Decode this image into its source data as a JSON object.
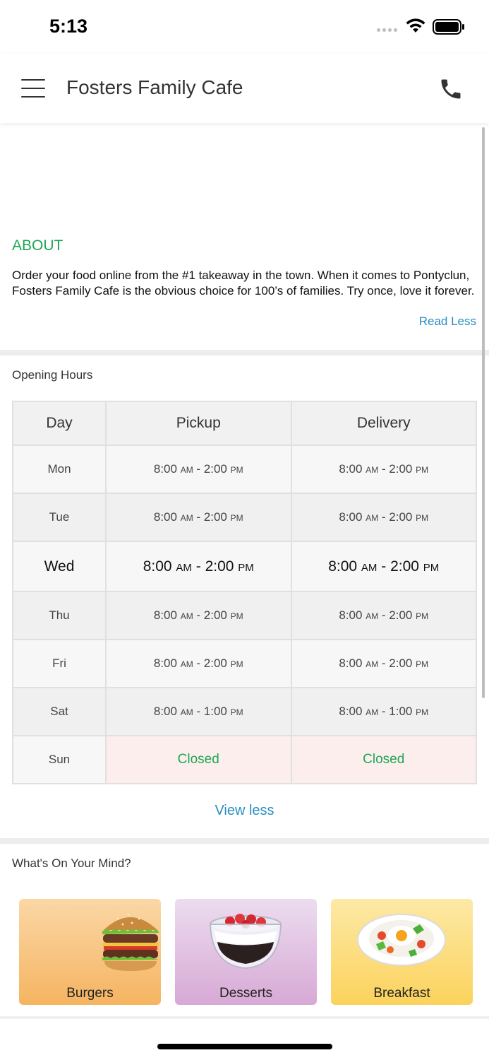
{
  "status": {
    "time": "5:13"
  },
  "header": {
    "title": "Fosters Family Cafe"
  },
  "about": {
    "title": "ABOUT",
    "text": "Order your food online from the #1 takeaway in the town. When it comes to Pontyclun, Fosters Family Cafe is the obvious choice for 100’s of families. Try once, love it forever.",
    "toggle": "Read Less"
  },
  "hours": {
    "title": "Opening Hours",
    "columns": [
      "Day",
      "Pickup",
      "Delivery"
    ],
    "rows": [
      {
        "day": "Mon",
        "pickup_open": "8:00",
        "pickup_open_ampm": "AM",
        "pickup_close": "2:00",
        "pickup_close_ampm": "PM",
        "delivery_open": "8:00",
        "delivery_open_ampm": "AM",
        "delivery_close": "2:00",
        "delivery_close_ampm": "PM"
      },
      {
        "day": "Tue",
        "pickup_open": "8:00",
        "pickup_open_ampm": "AM",
        "pickup_close": "2:00",
        "pickup_close_ampm": "PM",
        "delivery_open": "8:00",
        "delivery_open_ampm": "AM",
        "delivery_close": "2:00",
        "delivery_close_ampm": "PM"
      },
      {
        "day": "Wed",
        "pickup_open": "8:00",
        "pickup_open_ampm": "AM",
        "pickup_close": "2:00",
        "pickup_close_ampm": "PM",
        "delivery_open": "8:00",
        "delivery_open_ampm": "AM",
        "delivery_close": "2:00",
        "delivery_close_ampm": "PM"
      },
      {
        "day": "Thu",
        "pickup_open": "8:00",
        "pickup_open_ampm": "AM",
        "pickup_close": "2:00",
        "pickup_close_ampm": "PM",
        "delivery_open": "8:00",
        "delivery_open_ampm": "AM",
        "delivery_close": "2:00",
        "delivery_close_ampm": "PM"
      },
      {
        "day": "Fri",
        "pickup_open": "8:00",
        "pickup_open_ampm": "AM",
        "pickup_close": "2:00",
        "pickup_close_ampm": "PM",
        "delivery_open": "8:00",
        "delivery_open_ampm": "AM",
        "delivery_close": "2:00",
        "delivery_close_ampm": "PM"
      },
      {
        "day": "Sat",
        "pickup_open": "8:00",
        "pickup_open_ampm": "AM",
        "pickup_close": "1:00",
        "pickup_close_ampm": "PM",
        "delivery_open": "8:00",
        "delivery_open_ampm": "AM",
        "delivery_close": "1:00",
        "delivery_close_ampm": "PM"
      },
      {
        "day": "Sun",
        "pickup": "Closed",
        "delivery": "Closed"
      }
    ],
    "toggle": "View less"
  },
  "mind": {
    "title": "What's On Your Mind?",
    "categories": [
      {
        "label": "Burgers",
        "icon": "burger-icon",
        "colors": [
          "#fbd7a6",
          "#f5b461"
        ]
      },
      {
        "label": "Desserts",
        "icon": "dessert-bowl-icon",
        "colors": [
          "#ecdcef",
          "#d7a9d5"
        ]
      },
      {
        "label": "Breakfast",
        "icon": "breakfast-plate-icon",
        "colors": [
          "#fde9a6",
          "#fbd25c"
        ]
      }
    ]
  },
  "colors": {
    "accent_green": "#1ea654",
    "link_blue": "#2a8fc1",
    "closed_bg": "#fdeeee"
  }
}
